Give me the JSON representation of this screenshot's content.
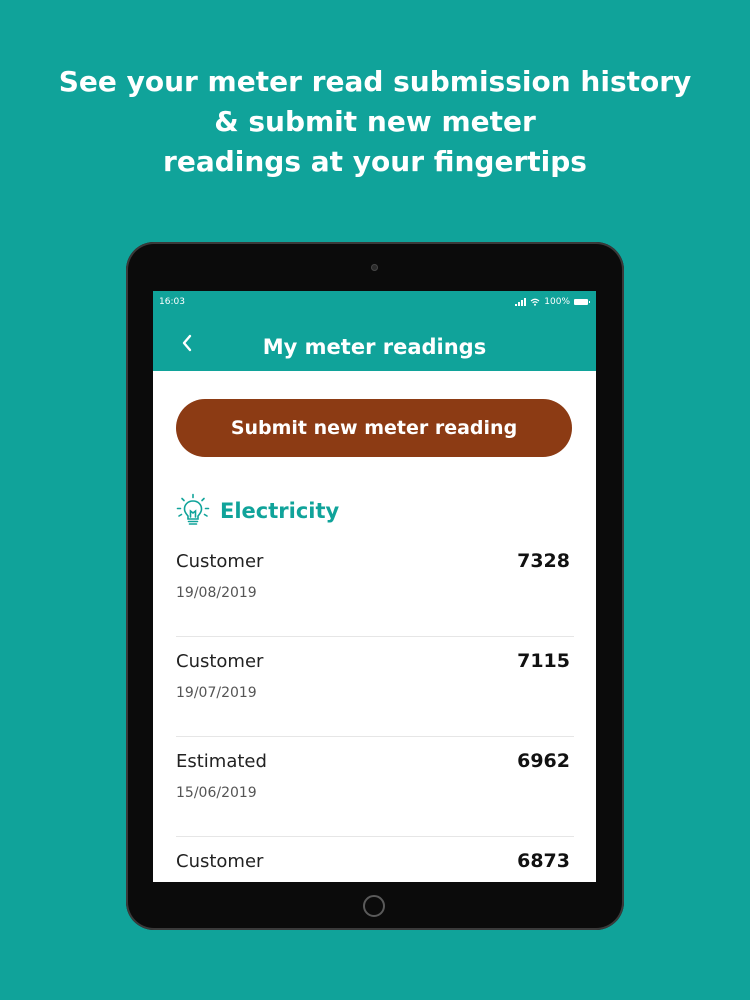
{
  "headline": {
    "line1": "See your meter read submission history",
    "line2": "& submit new meter",
    "line3": "readings at your fingertips"
  },
  "status_bar": {
    "time": "16:03",
    "battery": "100%"
  },
  "header": {
    "title": "My meter readings",
    "back_icon": "chevron-left-icon"
  },
  "actions": {
    "submit_label": "Submit new meter reading"
  },
  "section": {
    "title": "Electricity",
    "icon": "lightbulb-icon"
  },
  "readings": [
    {
      "type": "Customer",
      "date": "19/08/2019",
      "value": "7328"
    },
    {
      "type": "Customer",
      "date": "19/07/2019",
      "value": "7115"
    },
    {
      "type": "Estimated",
      "date": "15/06/2019",
      "value": "6962"
    },
    {
      "type": "Customer",
      "date": "",
      "value": "6873"
    }
  ],
  "colors": {
    "brand": "#10a39a",
    "button": "#8c3b14",
    "background": "#10a39a"
  }
}
